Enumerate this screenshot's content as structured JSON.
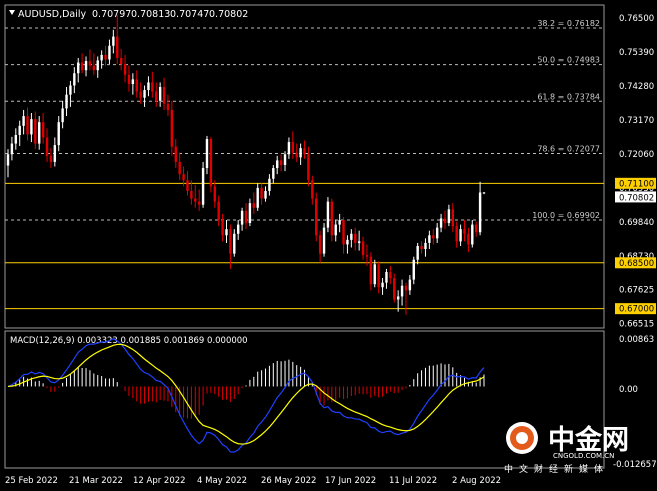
{
  "chart_data": [
    {
      "type": "candlestick",
      "header": {
        "symbol": "AUDUSD,Daily",
        "ohlc": [
          "0.70797",
          "0.70813",
          "0.70747",
          "0.70802"
        ]
      },
      "ylim": [
        0.664,
        0.769
      ],
      "y_ticks": [
        "0.76500",
        "0.75390",
        "0.74280",
        "0.73170",
        "0.72060",
        "0.70950",
        "0.69840",
        "0.68730",
        "0.67625",
        "0.66515"
      ],
      "x_tick_labels": [
        "25 Feb 2022",
        "21 Mar 2022",
        "12 Apr 2022",
        "4 May 2022",
        "26 May 2022",
        "17 Jun 2022",
        "11 Jul 2022",
        "2 Aug 2022"
      ],
      "fib_levels": [
        {
          "label": "38.2 = 0.76182",
          "value": 0.76182
        },
        {
          "label": "50.0 = 0.74983",
          "value": 0.74983
        },
        {
          "label": "61.8 = 0.73784",
          "value": 0.73784
        },
        {
          "label": "78.6 = 0.72077",
          "value": 0.72077
        },
        {
          "label": "100.0 = 0.69902",
          "value": 0.69902
        }
      ],
      "horizontal_lines": [
        {
          "label": "0.71100",
          "value": 0.711
        },
        {
          "label": "0.68500",
          "value": 0.685
        },
        {
          "label": "0.67000",
          "value": 0.67
        }
      ],
      "current_price": {
        "label": "0.70802",
        "value": 0.70802
      },
      "colors": {
        "bull": "#ffffff",
        "bear": "#e00000",
        "level": "#ffd000",
        "fib": "#cccccc",
        "background": "#000000"
      },
      "grid": false,
      "candles": [
        {
          "date": "2022-02-21",
          "o": 0.7168,
          "h": 0.7222,
          "l": 0.713,
          "c": 0.7205
        },
        {
          "date": "2022-02-22",
          "o": 0.7205,
          "h": 0.7262,
          "l": 0.7185,
          "c": 0.724
        },
        {
          "date": "2022-02-23",
          "o": 0.724,
          "h": 0.729,
          "l": 0.722,
          "c": 0.7268
        },
        {
          "date": "2022-02-24",
          "o": 0.7268,
          "h": 0.7315,
          "l": 0.7232,
          "c": 0.7298
        },
        {
          "date": "2022-02-25",
          "o": 0.7298,
          "h": 0.735,
          "l": 0.727,
          "c": 0.733
        },
        {
          "date": "2022-02-28",
          "o": 0.733,
          "h": 0.7358,
          "l": 0.725,
          "c": 0.727
        },
        {
          "date": "2022-03-01",
          "o": 0.727,
          "h": 0.734,
          "l": 0.7245,
          "c": 0.732
        },
        {
          "date": "2022-03-02",
          "o": 0.732,
          "h": 0.7345,
          "l": 0.7222,
          "c": 0.724
        },
        {
          "date": "2022-03-03",
          "o": 0.724,
          "h": 0.733,
          "l": 0.722,
          "c": 0.731
        },
        {
          "date": "2022-03-04",
          "o": 0.731,
          "h": 0.734,
          "l": 0.724,
          "c": 0.726
        },
        {
          "date": "2022-03-07",
          "o": 0.726,
          "h": 0.729,
          "l": 0.718,
          "c": 0.72
        },
        {
          "date": "2022-03-08",
          "o": 0.72,
          "h": 0.7225,
          "l": 0.716,
          "c": 0.718
        },
        {
          "date": "2022-03-09",
          "o": 0.718,
          "h": 0.726,
          "l": 0.7165,
          "c": 0.7235
        },
        {
          "date": "2022-03-10",
          "o": 0.7235,
          "h": 0.733,
          "l": 0.7215,
          "c": 0.731
        },
        {
          "date": "2022-03-11",
          "o": 0.731,
          "h": 0.738,
          "l": 0.729,
          "c": 0.7355
        },
        {
          "date": "2022-03-14",
          "o": 0.7355,
          "h": 0.7425,
          "l": 0.733,
          "c": 0.74
        },
        {
          "date": "2022-03-15",
          "o": 0.74,
          "h": 0.7445,
          "l": 0.736,
          "c": 0.743
        },
        {
          "date": "2022-03-16",
          "o": 0.743,
          "h": 0.749,
          "l": 0.7405,
          "c": 0.747
        },
        {
          "date": "2022-03-17",
          "o": 0.747,
          "h": 0.752,
          "l": 0.744,
          "c": 0.7505
        },
        {
          "date": "2022-03-18",
          "o": 0.7505,
          "h": 0.7535,
          "l": 0.747,
          "c": 0.748
        },
        {
          "date": "2022-03-21",
          "o": 0.748,
          "h": 0.7525,
          "l": 0.746,
          "c": 0.751
        },
        {
          "date": "2022-03-22",
          "o": 0.751,
          "h": 0.7548,
          "l": 0.748,
          "c": 0.7495
        },
        {
          "date": "2022-03-23",
          "o": 0.7495,
          "h": 0.7535,
          "l": 0.7465,
          "c": 0.748
        },
        {
          "date": "2022-03-24",
          "o": 0.748,
          "h": 0.7525,
          "l": 0.7455,
          "c": 0.7512
        },
        {
          "date": "2022-03-25",
          "o": 0.7512,
          "h": 0.7545,
          "l": 0.7485,
          "c": 0.753
        },
        {
          "date": "2022-03-28",
          "o": 0.753,
          "h": 0.756,
          "l": 0.7495,
          "c": 0.7515
        },
        {
          "date": "2022-03-29",
          "o": 0.7515,
          "h": 0.758,
          "l": 0.75,
          "c": 0.756
        },
        {
          "date": "2022-03-30",
          "o": 0.756,
          "h": 0.7612,
          "l": 0.7535,
          "c": 0.759
        },
        {
          "date": "2022-03-31",
          "o": 0.759,
          "h": 0.766,
          "l": 0.75,
          "c": 0.752
        },
        {
          "date": "2022-04-01",
          "o": 0.752,
          "h": 0.755,
          "l": 0.748,
          "c": 0.75
        },
        {
          "date": "2022-04-04",
          "o": 0.75,
          "h": 0.753,
          "l": 0.744,
          "c": 0.7465
        },
        {
          "date": "2022-04-05",
          "o": 0.7465,
          "h": 0.7495,
          "l": 0.741,
          "c": 0.7435
        },
        {
          "date": "2022-04-06",
          "o": 0.7435,
          "h": 0.747,
          "l": 0.74,
          "c": 0.745
        },
        {
          "date": "2022-04-07",
          "o": 0.745,
          "h": 0.748,
          "l": 0.739,
          "c": 0.741
        },
        {
          "date": "2022-04-08",
          "o": 0.741,
          "h": 0.744,
          "l": 0.737,
          "c": 0.739
        },
        {
          "date": "2022-04-11",
          "o": 0.739,
          "h": 0.743,
          "l": 0.736,
          "c": 0.7415
        },
        {
          "date": "2022-04-12",
          "o": 0.7415,
          "h": 0.746,
          "l": 0.7395,
          "c": 0.744
        },
        {
          "date": "2022-04-13",
          "o": 0.744,
          "h": 0.7475,
          "l": 0.739,
          "c": 0.741
        },
        {
          "date": "2022-04-14",
          "o": 0.741,
          "h": 0.744,
          "l": 0.736,
          "c": 0.738
        },
        {
          "date": "2022-04-18",
          "o": 0.738,
          "h": 0.744,
          "l": 0.736,
          "c": 0.7425
        },
        {
          "date": "2022-04-19",
          "o": 0.7425,
          "h": 0.7455,
          "l": 0.735,
          "c": 0.737
        },
        {
          "date": "2022-04-20",
          "o": 0.737,
          "h": 0.74,
          "l": 0.733,
          "c": 0.735
        },
        {
          "date": "2022-04-21",
          "o": 0.735,
          "h": 0.738,
          "l": 0.72,
          "c": 0.723
        },
        {
          "date": "2022-04-22",
          "o": 0.723,
          "h": 0.7255,
          "l": 0.716,
          "c": 0.718
        },
        {
          "date": "2022-04-25",
          "o": 0.718,
          "h": 0.721,
          "l": 0.712,
          "c": 0.714
        },
        {
          "date": "2022-04-26",
          "o": 0.714,
          "h": 0.7165,
          "l": 0.71,
          "c": 0.712
        },
        {
          "date": "2022-04-27",
          "o": 0.712,
          "h": 0.715,
          "l": 0.707,
          "c": 0.7085
        },
        {
          "date": "2022-04-28",
          "o": 0.7085,
          "h": 0.712,
          "l": 0.704,
          "c": 0.706
        },
        {
          "date": "2022-04-29",
          "o": 0.706,
          "h": 0.7105,
          "l": 0.703,
          "c": 0.705
        },
        {
          "date": "2022-05-02",
          "o": 0.705,
          "h": 0.709,
          "l": 0.702,
          "c": 0.704
        },
        {
          "date": "2022-05-03",
          "o": 0.704,
          "h": 0.718,
          "l": 0.703,
          "c": 0.716
        },
        {
          "date": "2022-05-04",
          "o": 0.716,
          "h": 0.7265,
          "l": 0.714,
          "c": 0.7255
        },
        {
          "date": "2022-05-05",
          "o": 0.7255,
          "h": 0.7262,
          "l": 0.708,
          "c": 0.71
        },
        {
          "date": "2022-05-06",
          "o": 0.71,
          "h": 0.712,
          "l": 0.703,
          "c": 0.705
        },
        {
          "date": "2022-05-09",
          "o": 0.705,
          "h": 0.707,
          "l": 0.697,
          "c": 0.699
        },
        {
          "date": "2022-05-10",
          "o": 0.699,
          "h": 0.701,
          "l": 0.692,
          "c": 0.694
        },
        {
          "date": "2022-05-11",
          "o": 0.694,
          "h": 0.699,
          "l": 0.6915,
          "c": 0.696
        },
        {
          "date": "2022-05-12",
          "o": 0.696,
          "h": 0.6975,
          "l": 0.683,
          "c": 0.688
        },
        {
          "date": "2022-05-13",
          "o": 0.688,
          "h": 0.696,
          "l": 0.687,
          "c": 0.6945
        },
        {
          "date": "2022-05-16",
          "o": 0.6945,
          "h": 0.699,
          "l": 0.6925,
          "c": 0.6975
        },
        {
          "date": "2022-05-17",
          "o": 0.6975,
          "h": 0.703,
          "l": 0.6955,
          "c": 0.702
        },
        {
          "date": "2022-05-18",
          "o": 0.702,
          "h": 0.7045,
          "l": 0.696,
          "c": 0.698
        },
        {
          "date": "2022-05-19",
          "o": 0.698,
          "h": 0.706,
          "l": 0.697,
          "c": 0.7045
        },
        {
          "date": "2022-05-20",
          "o": 0.7045,
          "h": 0.708,
          "l": 0.701,
          "c": 0.703
        },
        {
          "date": "2022-05-23",
          "o": 0.703,
          "h": 0.711,
          "l": 0.702,
          "c": 0.7095
        },
        {
          "date": "2022-05-24",
          "o": 0.7095,
          "h": 0.711,
          "l": 0.704,
          "c": 0.706
        },
        {
          "date": "2022-05-25",
          "o": 0.706,
          "h": 0.71,
          "l": 0.705,
          "c": 0.7085
        },
        {
          "date": "2022-05-26",
          "o": 0.7085,
          "h": 0.714,
          "l": 0.707,
          "c": 0.7125
        },
        {
          "date": "2022-05-27",
          "o": 0.7125,
          "h": 0.717,
          "l": 0.711,
          "c": 0.716
        },
        {
          "date": "2022-05-30",
          "o": 0.716,
          "h": 0.72,
          "l": 0.714,
          "c": 0.7185
        },
        {
          "date": "2022-05-31",
          "o": 0.7185,
          "h": 0.7205,
          "l": 0.715,
          "c": 0.717
        },
        {
          "date": "2022-06-01",
          "o": 0.717,
          "h": 0.7215,
          "l": 0.715,
          "c": 0.7205
        },
        {
          "date": "2022-06-02",
          "o": 0.7205,
          "h": 0.726,
          "l": 0.719,
          "c": 0.7245
        },
        {
          "date": "2022-06-03",
          "o": 0.7245,
          "h": 0.728,
          "l": 0.719,
          "c": 0.721
        },
        {
          "date": "2022-06-06",
          "o": 0.721,
          "h": 0.724,
          "l": 0.718,
          "c": 0.7195
        },
        {
          "date": "2022-06-07",
          "o": 0.7195,
          "h": 0.724,
          "l": 0.717,
          "c": 0.7225
        },
        {
          "date": "2022-06-08",
          "o": 0.7225,
          "h": 0.725,
          "l": 0.719,
          "c": 0.7205
        },
        {
          "date": "2022-06-09",
          "o": 0.7205,
          "h": 0.723,
          "l": 0.71,
          "c": 0.712
        },
        {
          "date": "2022-06-10",
          "o": 0.712,
          "h": 0.7135,
          "l": 0.704,
          "c": 0.706
        },
        {
          "date": "2022-06-13",
          "o": 0.706,
          "h": 0.708,
          "l": 0.692,
          "c": 0.694
        },
        {
          "date": "2022-06-14",
          "o": 0.694,
          "h": 0.6955,
          "l": 0.685,
          "c": 0.688
        },
        {
          "date": "2022-06-15",
          "o": 0.688,
          "h": 0.698,
          "l": 0.687,
          "c": 0.6965
        },
        {
          "date": "2022-06-16",
          "o": 0.6965,
          "h": 0.7065,
          "l": 0.695,
          "c": 0.705
        },
        {
          "date": "2022-06-17",
          "o": 0.705,
          "h": 0.706,
          "l": 0.692,
          "c": 0.694
        },
        {
          "date": "2022-06-20",
          "o": 0.694,
          "h": 0.699,
          "l": 0.692,
          "c": 0.6975
        },
        {
          "date": "2022-06-21",
          "o": 0.6975,
          "h": 0.701,
          "l": 0.695,
          "c": 0.699
        },
        {
          "date": "2022-06-22",
          "o": 0.699,
          "h": 0.7,
          "l": 0.688,
          "c": 0.691
        },
        {
          "date": "2022-06-23",
          "o": 0.691,
          "h": 0.694,
          "l": 0.688,
          "c": 0.6925
        },
        {
          "date": "2022-06-24",
          "o": 0.6925,
          "h": 0.696,
          "l": 0.69,
          "c": 0.6945
        },
        {
          "date": "2022-06-27",
          "o": 0.6945,
          "h": 0.6965,
          "l": 0.689,
          "c": 0.6915
        },
        {
          "date": "2022-06-28",
          "o": 0.6915,
          "h": 0.6955,
          "l": 0.689,
          "c": 0.692
        },
        {
          "date": "2022-06-29",
          "o": 0.692,
          "h": 0.6935,
          "l": 0.686,
          "c": 0.6875
        },
        {
          "date": "2022-06-30",
          "o": 0.6875,
          "h": 0.691,
          "l": 0.684,
          "c": 0.687
        },
        {
          "date": "2022-07-01",
          "o": 0.687,
          "h": 0.6885,
          "l": 0.676,
          "c": 0.678
        },
        {
          "date": "2022-07-04",
          "o": 0.678,
          "h": 0.686,
          "l": 0.677,
          "c": 0.6845
        },
        {
          "date": "2022-07-05",
          "o": 0.6845,
          "h": 0.6855,
          "l": 0.675,
          "c": 0.677
        },
        {
          "date": "2022-07-06",
          "o": 0.677,
          "h": 0.68,
          "l": 0.6745,
          "c": 0.6785
        },
        {
          "date": "2022-07-07",
          "o": 0.6785,
          "h": 0.683,
          "l": 0.6765,
          "c": 0.682
        },
        {
          "date": "2022-07-08",
          "o": 0.682,
          "h": 0.684,
          "l": 0.678,
          "c": 0.68
        },
        {
          "date": "2022-07-11",
          "o": 0.68,
          "h": 0.6815,
          "l": 0.672,
          "c": 0.673
        },
        {
          "date": "2022-07-12",
          "o": 0.673,
          "h": 0.676,
          "l": 0.669,
          "c": 0.674
        },
        {
          "date": "2022-07-13",
          "o": 0.674,
          "h": 0.6795,
          "l": 0.671,
          "c": 0.6775
        },
        {
          "date": "2022-07-14",
          "o": 0.6775,
          "h": 0.6785,
          "l": 0.668,
          "c": 0.676
        },
        {
          "date": "2022-07-15",
          "o": 0.676,
          "h": 0.681,
          "l": 0.6745,
          "c": 0.6795
        },
        {
          "date": "2022-07-18",
          "o": 0.6795,
          "h": 0.687,
          "l": 0.678,
          "c": 0.686
        },
        {
          "date": "2022-07-19",
          "o": 0.686,
          "h": 0.6915,
          "l": 0.6845,
          "c": 0.6905
        },
        {
          "date": "2022-07-20",
          "o": 0.6905,
          "h": 0.692,
          "l": 0.688,
          "c": 0.6895
        },
        {
          "date": "2022-07-21",
          "o": 0.6895,
          "h": 0.693,
          "l": 0.687,
          "c": 0.6915
        },
        {
          "date": "2022-07-22",
          "o": 0.6915,
          "h": 0.6955,
          "l": 0.6895,
          "c": 0.694
        },
        {
          "date": "2022-07-25",
          "o": 0.694,
          "h": 0.696,
          "l": 0.691,
          "c": 0.693
        },
        {
          "date": "2022-07-26",
          "o": 0.693,
          "h": 0.698,
          "l": 0.6915,
          "c": 0.6965
        },
        {
          "date": "2022-07-27",
          "o": 0.6965,
          "h": 0.701,
          "l": 0.695,
          "c": 0.6995
        },
        {
          "date": "2022-07-28",
          "o": 0.6995,
          "h": 0.702,
          "l": 0.696,
          "c": 0.698
        },
        {
          "date": "2022-07-29",
          "o": 0.698,
          "h": 0.704,
          "l": 0.697,
          "c": 0.7025
        },
        {
          "date": "2022-08-01",
          "o": 0.7025,
          "h": 0.7045,
          "l": 0.695,
          "c": 0.697
        },
        {
          "date": "2022-08-02",
          "o": 0.697,
          "h": 0.6985,
          "l": 0.69,
          "c": 0.692
        },
        {
          "date": "2022-08-03",
          "o": 0.692,
          "h": 0.6975,
          "l": 0.6905,
          "c": 0.696
        },
        {
          "date": "2022-08-04",
          "o": 0.696,
          "h": 0.699,
          "l": 0.692,
          "c": 0.6945
        },
        {
          "date": "2022-08-05",
          "o": 0.6945,
          "h": 0.6965,
          "l": 0.6885,
          "c": 0.691
        },
        {
          "date": "2022-08-08",
          "o": 0.691,
          "h": 0.699,
          "l": 0.69,
          "c": 0.6975
        },
        {
          "date": "2022-08-09",
          "o": 0.6975,
          "h": 0.6985,
          "l": 0.6935,
          "c": 0.695
        },
        {
          "date": "2022-08-10",
          "o": 0.695,
          "h": 0.7115,
          "l": 0.694,
          "c": 0.708
        },
        {
          "date": "2022-08-11",
          "o": 0.70797,
          "h": 0.70813,
          "l": 0.70747,
          "c": 0.70802
        }
      ]
    },
    {
      "type": "macd",
      "title": "MACD(12,26,9) 0.003323 0.001885 0.001869 0.000000",
      "ylim": [
        -0.0145,
        0.0098
      ],
      "y_ticks": [
        "0.00863",
        "0.00",
        "-0.012657"
      ],
      "colors": {
        "hist_pos": "#ffffff",
        "hist_neg": "#e00000",
        "macd": "#2040ff",
        "signal": "#ffff00"
      }
    }
  ],
  "watermark": {
    "brand": "中金网",
    "domain": "CNGOLD.COM.CN",
    "slogan": "中文财经新媒体"
  }
}
